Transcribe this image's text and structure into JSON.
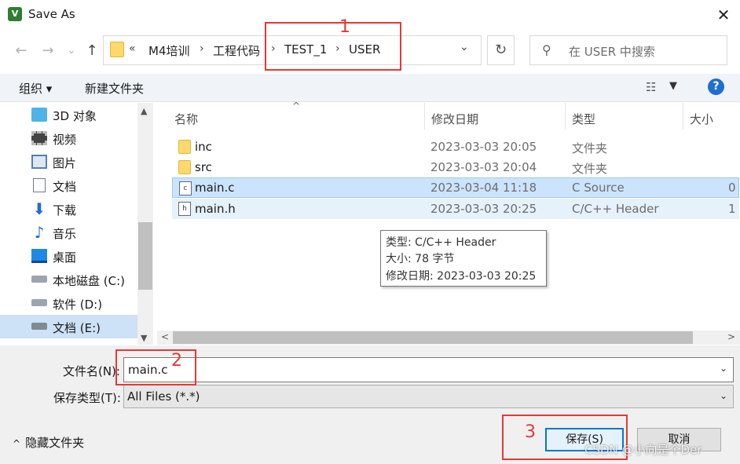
{
  "window": {
    "title": "Save As",
    "app_icon": "keil-icon"
  },
  "nav": {
    "back_glyph": "←",
    "forward_glyph": "→",
    "recent_glyph": "⌄",
    "up_glyph": "↑",
    "breadcrumb": [
      "M4培训",
      "工程代码",
      "TEST_1",
      "USER"
    ],
    "overflow": "«",
    "search_placeholder": "在 USER 中搜索"
  },
  "toolbar": {
    "organize": "组织 ▾",
    "new_folder": "新建文件夹"
  },
  "sidebar": {
    "items": [
      {
        "label": "3D 对象",
        "icon": "cube-icon"
      },
      {
        "label": "视频",
        "icon": "film-icon"
      },
      {
        "label": "图片",
        "icon": "picture-icon"
      },
      {
        "label": "文档",
        "icon": "document-icon"
      },
      {
        "label": "下载",
        "icon": "download-arrow-icon"
      },
      {
        "label": "音乐",
        "icon": "music-note-icon"
      },
      {
        "label": "桌面",
        "icon": "desktop-icon"
      },
      {
        "label": "本地磁盘 (C:)",
        "icon": "drive-icon"
      },
      {
        "label": "软件 (D:)",
        "icon": "drive-icon"
      },
      {
        "label": "文档 (E:)",
        "icon": "drive-icon"
      }
    ]
  },
  "filelist": {
    "columns": {
      "name": "名称",
      "date": "修改日期",
      "type": "类型",
      "size": "大小"
    },
    "rows": [
      {
        "name": "inc",
        "date": "2023-03-03 20:05",
        "type": "文件夹",
        "size": "",
        "icon": "folder-icon"
      },
      {
        "name": "src",
        "date": "2023-03-03 20:04",
        "type": "文件夹",
        "size": "",
        "icon": "folder-icon"
      },
      {
        "name": "main.c",
        "date": "2023-03-04 11:18",
        "type": "C Source",
        "size": "0",
        "icon": "c-file-icon"
      },
      {
        "name": "main.h",
        "date": "2023-03-03 20:25",
        "type": "C/C++ Header",
        "size": "1",
        "icon": "h-file-icon"
      }
    ],
    "tooltip": [
      "类型: C/C++ Header",
      "大小: 78 字节",
      "修改日期: 2023-03-03 20:25"
    ]
  },
  "form": {
    "filename_label": "文件名(N):",
    "filename_value": "main.c",
    "filetype_label": "保存类型(T):",
    "filetype_value": "All Files (*.*)",
    "hide_folders": "隐藏文件夹",
    "save": "保存(S)",
    "cancel": "取消"
  },
  "annotations": {
    "one": "1",
    "two": "2",
    "three": "3",
    "color": "#e53935"
  },
  "watermark": "CSDN @小向是个Der"
}
